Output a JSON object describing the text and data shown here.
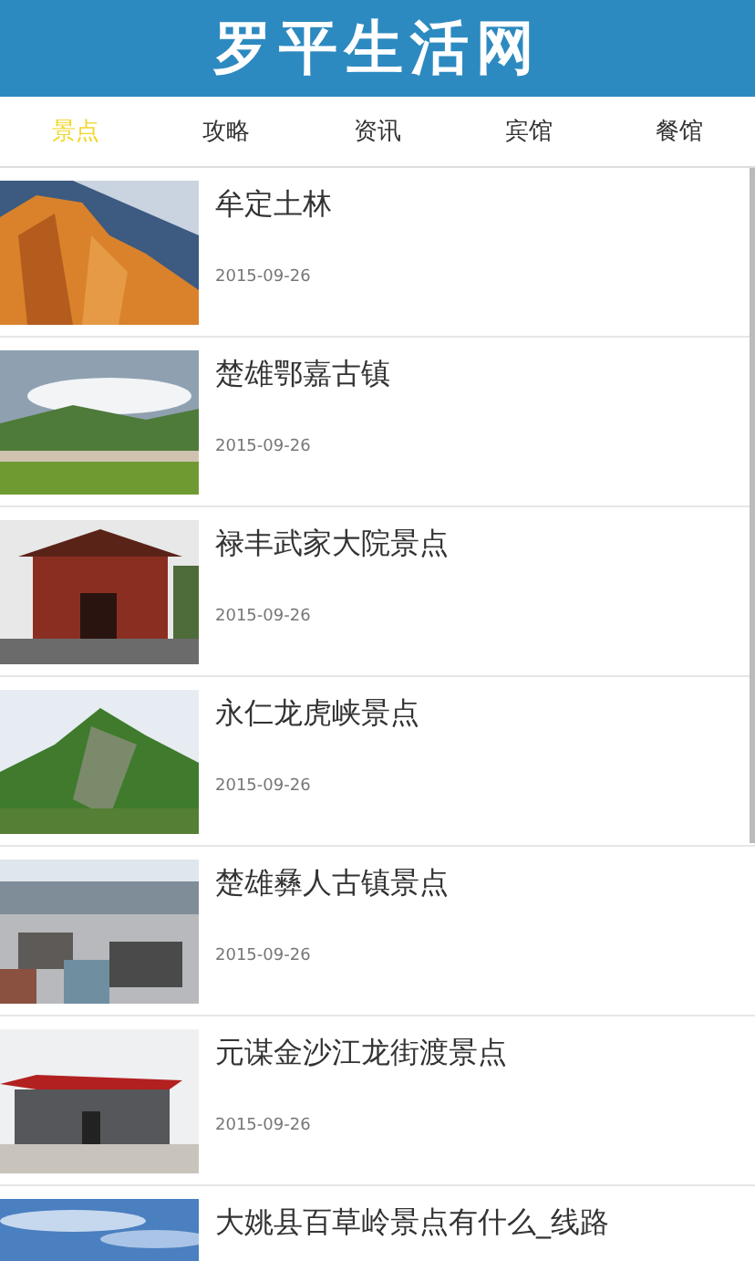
{
  "header": {
    "title": "罗平生活网"
  },
  "tabs": [
    {
      "label": "景点",
      "selected": true
    },
    {
      "label": "攻略",
      "selected": false
    },
    {
      "label": "资讯",
      "selected": false
    },
    {
      "label": "宾馆",
      "selected": false
    },
    {
      "label": "餐馆",
      "selected": false
    }
  ],
  "articles": [
    {
      "title": "牟定土林",
      "date": "2015-09-26"
    },
    {
      "title": "楚雄鄂嘉古镇",
      "date": "2015-09-26"
    },
    {
      "title": "禄丰武家大院景点",
      "date": "2015-09-26"
    },
    {
      "title": "永仁龙虎峡景点",
      "date": "2015-09-26"
    },
    {
      "title": "楚雄彝人古镇景点",
      "date": "2015-09-26"
    },
    {
      "title": "元谋金沙江龙街渡景点",
      "date": "2015-09-26"
    },
    {
      "title": "大姚县百草岭景点有什么_线路"
    }
  ]
}
